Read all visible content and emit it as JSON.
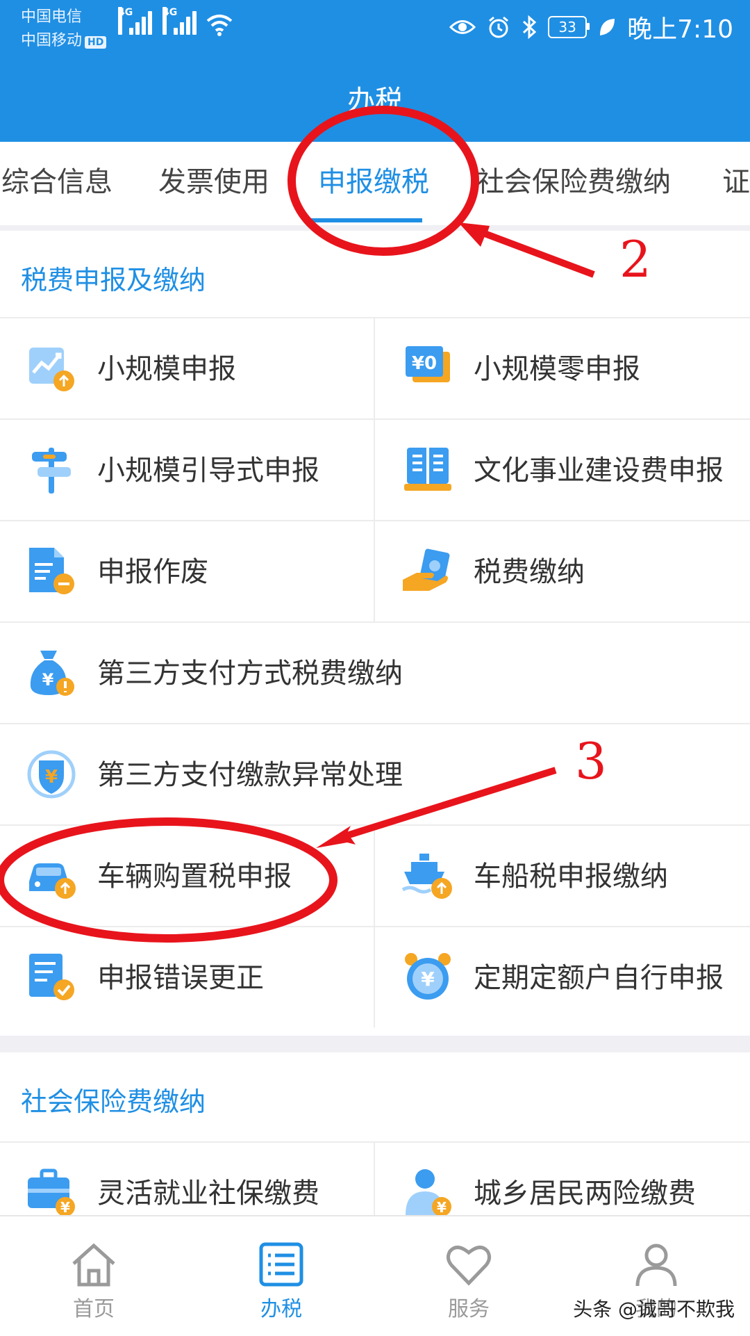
{
  "status_bar": {
    "carrier_1": "中国电信",
    "carrier_2": "中国移动",
    "hd_badge": "HD",
    "network_1": "4G",
    "network_2": "4G",
    "battery": "33",
    "time": "晚上7:10"
  },
  "header": {
    "title": "办税"
  },
  "tabs": [
    {
      "label": "综合信息",
      "active": false
    },
    {
      "label": "发票使用",
      "active": false
    },
    {
      "label": "申报缴税",
      "active": true
    },
    {
      "label": "社会保险费缴纳",
      "active": false
    },
    {
      "label": "证",
      "active": false
    }
  ],
  "sections": [
    {
      "title": "税费申报及缴纳",
      "items": [
        {
          "label": "小规模申报",
          "icon": "chart-upload-icon"
        },
        {
          "label": "小规模零申报",
          "icon": "yen-zero-icon"
        },
        {
          "label": "小规模引导式申报",
          "icon": "signpost-icon"
        },
        {
          "label": "文化事业建设费申报",
          "icon": "open-book-icon"
        },
        {
          "label": "申报作废",
          "icon": "document-minus-icon"
        },
        {
          "label": "税费缴纳",
          "icon": "hand-money-icon"
        },
        {
          "label": "第三方支付方式税费缴纳",
          "icon": "money-bag-icon"
        },
        {
          "label": "第三方支付缴款异常处理",
          "icon": "shield-yen-icon"
        },
        {
          "label": "车辆购置税申报",
          "icon": "car-upload-icon"
        },
        {
          "label": "车船税申报缴纳",
          "icon": "ship-upload-icon"
        },
        {
          "label": "申报错误更正",
          "icon": "document-check-icon"
        },
        {
          "label": "定期定额户自行申报",
          "icon": "alarm-clock-yen-icon"
        }
      ]
    },
    {
      "title": "社会保险费缴纳",
      "items": [
        {
          "label": "灵活就业社保缴费",
          "icon": "briefcase-yen-icon"
        },
        {
          "label": "城乡居民两险缴费",
          "icon": "person-yen-icon"
        }
      ]
    }
  ],
  "annotations": {
    "step_2": "2",
    "step_3": "3"
  },
  "bottom_nav": [
    {
      "label": "首页",
      "icon": "home-icon",
      "active": false
    },
    {
      "label": "办税",
      "icon": "list-icon",
      "active": true
    },
    {
      "label": "服务",
      "icon": "heart-icon",
      "active": false
    },
    {
      "label": "我的",
      "icon": "person-icon",
      "active": false
    }
  ],
  "watermark": "头条 @诚哥不欺我",
  "colors": {
    "primary": "#1f8fe4",
    "annotation": "#e8141c",
    "icon_orange": "#f5a623"
  }
}
